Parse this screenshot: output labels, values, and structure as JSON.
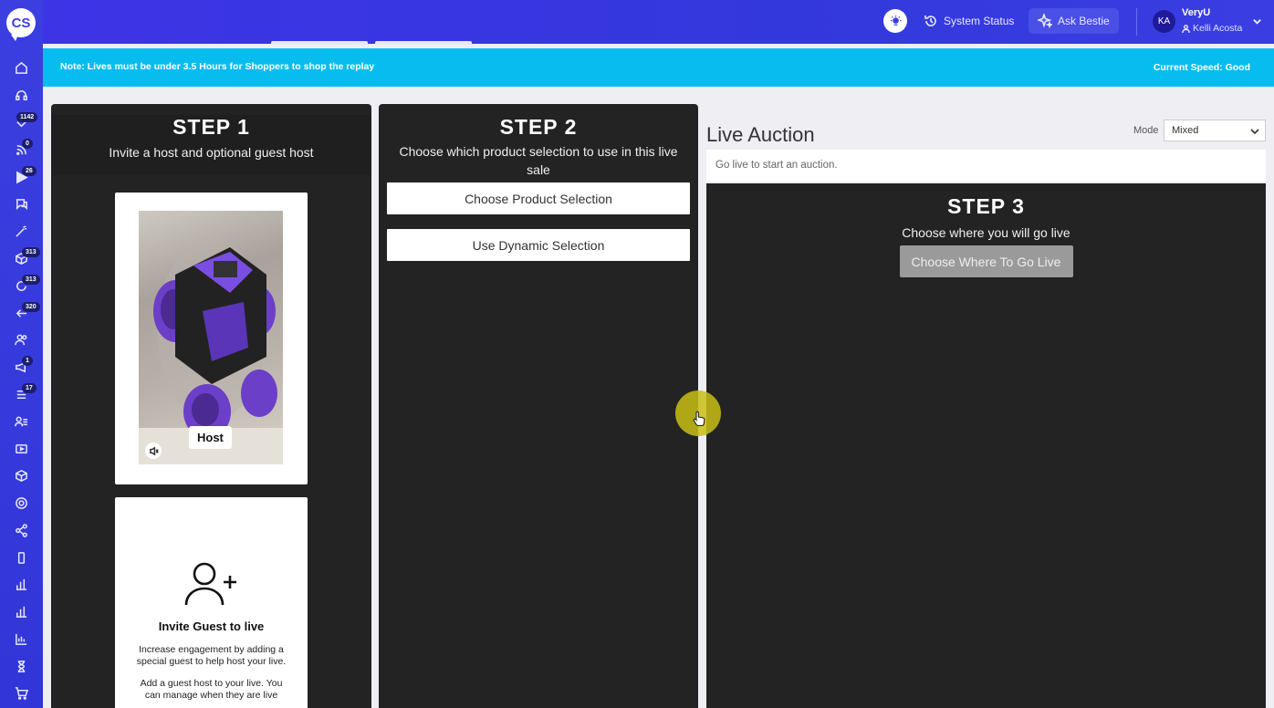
{
  "app": {
    "logo_text": "CS"
  },
  "sidebar": {
    "items": [
      {
        "icon": "home-icon"
      },
      {
        "icon": "headset-icon"
      },
      {
        "icon": "chevron-down-icon",
        "badge": "1142"
      },
      {
        "icon": "rss-icon",
        "badge": "0"
      },
      {
        "icon": "play-icon",
        "badge": "26"
      },
      {
        "icon": "chat-icon"
      },
      {
        "icon": "magic-wand-icon"
      },
      {
        "icon": "package-icon",
        "badge": "313"
      },
      {
        "icon": "refresh-icon",
        "badge": "313"
      },
      {
        "icon": "arrow-left-icon",
        "badge": "320"
      },
      {
        "icon": "users-icon"
      },
      {
        "icon": "megaphone-icon",
        "badge": "1"
      },
      {
        "icon": "list-icon",
        "badge": "17"
      },
      {
        "icon": "user-list-icon"
      },
      {
        "icon": "video-icon"
      },
      {
        "icon": "box-icon"
      },
      {
        "icon": "settings-icon"
      },
      {
        "icon": "share-icon"
      },
      {
        "icon": "mobile-icon"
      },
      {
        "icon": "bar-chart-icon"
      },
      {
        "icon": "bar-chart-alt-icon"
      },
      {
        "icon": "analytics-icon"
      },
      {
        "icon": "hourglass-icon"
      },
      {
        "icon": "cart-icon"
      }
    ]
  },
  "topbar": {
    "system_status": "System Status",
    "ask_bestie": "Ask Bestie",
    "avatar_initials": "KA",
    "org_name": "VeryU",
    "user_name": "Kelli Acosta"
  },
  "notice": {
    "left": "Note: Lives must be under 3.5 Hours for Shoppers to shop the replay",
    "right": "Current Speed: Good"
  },
  "step1": {
    "title": "STEP 1",
    "subtitle": "Invite a host and optional guest host",
    "host_label": "Host",
    "guest_title": "Invite Guest to live",
    "guest_desc": "Increase engagement by adding a special guest to help host your live.",
    "guest_desc2": "Add a guest host to your live. You can manage when they are live"
  },
  "step2": {
    "title": "STEP 2",
    "subtitle": "Choose which product selection to use in this live sale",
    "choose_button": "Choose Product Selection",
    "dynamic_button": "Use Dynamic Selection"
  },
  "auction": {
    "title": "Live Auction",
    "mode_label": "Mode",
    "mode_value": "Mixed",
    "message": "Go live to start an auction."
  },
  "step3": {
    "title": "STEP 3",
    "subtitle": "Choose where you will go live",
    "button": "Choose Where To Go Live"
  },
  "colors": {
    "sidebar": "#3b3fe0",
    "topbar": "#3d34e6",
    "notice": "#07bdf0",
    "panel": "#232323"
  }
}
